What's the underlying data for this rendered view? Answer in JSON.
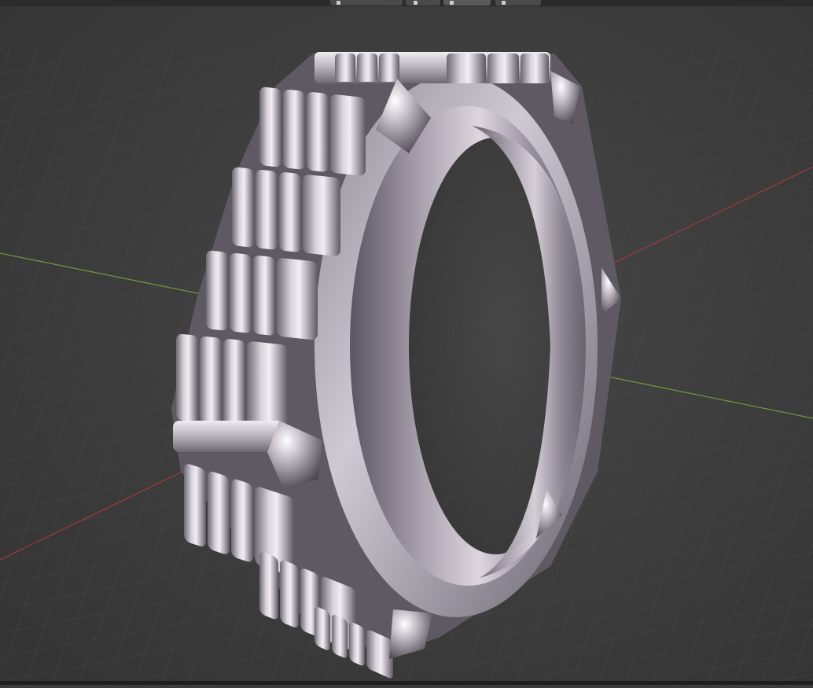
{
  "app": {
    "name": "3D viewport",
    "background_color": "#3d3d3d",
    "grid_color": "#4a4a4a",
    "x_axis_color": "#a33a3a",
    "y_axis_color": "#6f9a3a"
  },
  "header": {
    "left_menu": [
      "",
      "",
      ""
    ],
    "tools": [
      {
        "icon": "viewport-shading-icon",
        "label": ""
      },
      {
        "icon": "snap-icon",
        "label": ""
      },
      {
        "icon": "proportional-editing-icon",
        "label": ""
      },
      {
        "icon": "overlay-icon",
        "label": ""
      }
    ]
  },
  "scene": {
    "object": "ring",
    "material_color": "#c9c3cc",
    "segments_left_rows": 5,
    "studs_count": 6
  }
}
